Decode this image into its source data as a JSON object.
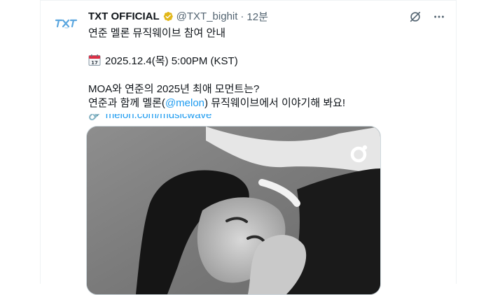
{
  "post": {
    "author_name": "TXT OFFICIAL",
    "handle": "@TXT_bighit",
    "separator": "·",
    "time": "12분",
    "avatar_text": "TXT"
  },
  "body": {
    "line1": "연준 멜론 뮤직웨이브 참여 안내",
    "date": "2025.12.4(목) 5:00PM (KST)",
    "line3": "MOA와 연준의 2025년 최애 모먼트는?",
    "line4_pre": "연준과 함께 멜론(",
    "line4_mention": "@melon",
    "line4_post": ") 뮤직웨이브에서 이야기해 봐요!",
    "truncated_link": "melon.com/musicwave"
  },
  "icons": {
    "verified": "verified-badge-icon",
    "grok": "grok-icon",
    "more": "more-icon",
    "calendar": "calendar-icon",
    "melon": "melon-logo-icon"
  },
  "colors": {
    "text": "#0f1419",
    "muted": "#536471",
    "link": "#1d9bf0",
    "verified_gold": "#e2b719"
  }
}
